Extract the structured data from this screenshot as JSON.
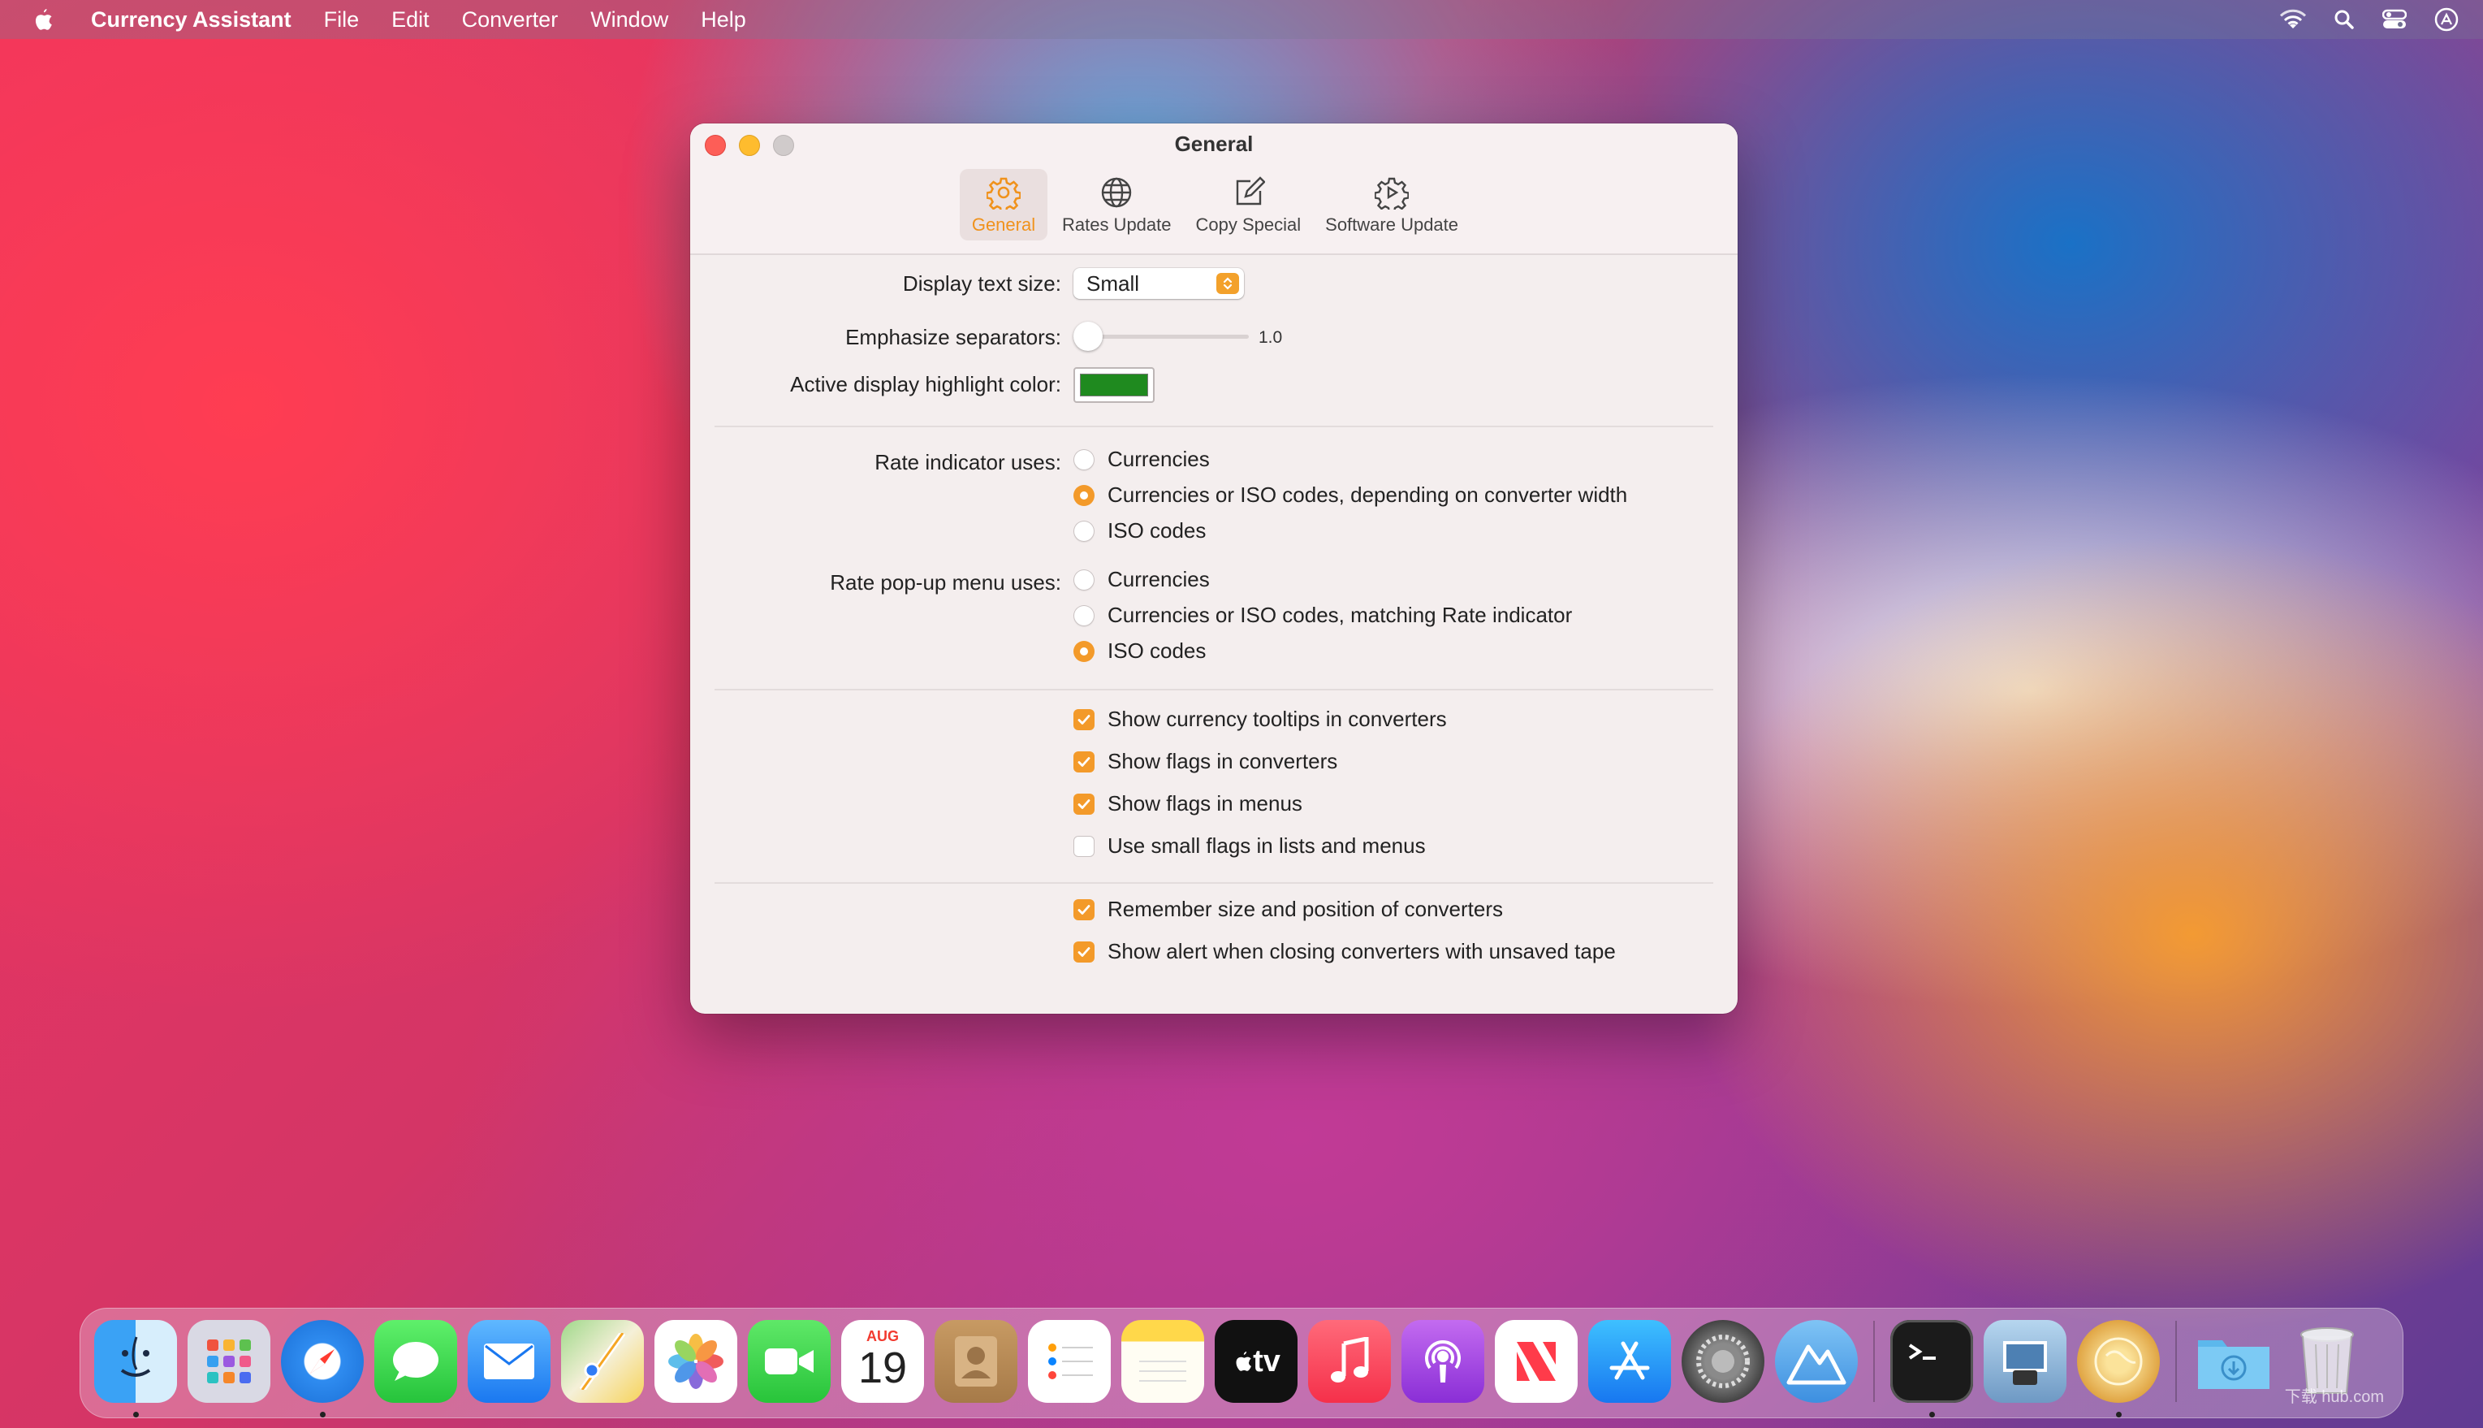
{
  "menubar": {
    "app_name": "Currency Assistant",
    "items": [
      "File",
      "Edit",
      "Converter",
      "Window",
      "Help"
    ]
  },
  "window": {
    "title": "General",
    "tabs": [
      {
        "label": "General",
        "icon": "gear-icon",
        "selected": true
      },
      {
        "label": "Rates Update",
        "icon": "globe-icon",
        "selected": false
      },
      {
        "label": "Copy Special",
        "icon": "edit-icon",
        "selected": false
      },
      {
        "label": "Software Update",
        "icon": "software-update-icon",
        "selected": false
      }
    ]
  },
  "general": {
    "display_text_size_label": "Display text size:",
    "display_text_size_value": "Small",
    "emphasize_separators_label": "Emphasize separators:",
    "emphasize_separators_value": "1.0",
    "highlight_color_label": "Active display highlight color:",
    "highlight_color": "#1f8a1f",
    "rate_indicator_label": "Rate indicator uses:",
    "rate_indicator_options": [
      {
        "label": "Currencies",
        "selected": false
      },
      {
        "label": "Currencies or ISO codes, depending on converter width",
        "selected": true
      },
      {
        "label": "ISO codes",
        "selected": false
      }
    ],
    "rate_popup_label": "Rate pop-up menu uses:",
    "rate_popup_options": [
      {
        "label": "Currencies",
        "selected": false
      },
      {
        "label": "Currencies or ISO codes, matching Rate indicator",
        "selected": false
      },
      {
        "label": "ISO codes",
        "selected": true
      }
    ],
    "checkboxes_group1": [
      {
        "label": "Show currency tooltips in converters",
        "checked": true
      },
      {
        "label": "Show flags in converters",
        "checked": true
      },
      {
        "label": "Show flags in menus",
        "checked": true
      },
      {
        "label": "Use small flags in lists and menus",
        "checked": false
      }
    ],
    "checkboxes_group2": [
      {
        "label": "Remember size and position of converters",
        "checked": true
      },
      {
        "label": "Show alert when closing converters with unsaved tape",
        "checked": true
      }
    ]
  },
  "accent_color": "#f39a2a",
  "dock": {
    "calendar_month": "AUG",
    "calendar_day": "19",
    "tv_label": "tv",
    "watermark": "下载 hub.com"
  }
}
